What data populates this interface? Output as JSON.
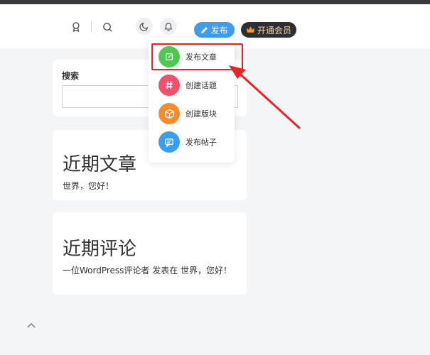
{
  "header": {
    "publish_label": "发布",
    "vip_label": "开通会员"
  },
  "search_widget": {
    "label": "搜索",
    "value": "",
    "placeholder": ""
  },
  "recent_posts": {
    "title": "近期文章",
    "items": [
      "世界，您好！"
    ]
  },
  "recent_comments": {
    "title": "近期评论",
    "items": [
      "一位WordPress评论者 发表在 世界，您好！"
    ]
  },
  "publish_menu": {
    "items": [
      {
        "label": "发布文章",
        "icon": "pencil-icon",
        "color": "#4cc94f"
      },
      {
        "label": "创建话题",
        "icon": "hashtag-icon",
        "color": "#f2506c"
      },
      {
        "label": "创建版块",
        "icon": "cube-icon",
        "color": "#f58b2d"
      },
      {
        "label": "发布帖子",
        "icon": "chat-bubble-icon",
        "color": "#3a9ef0"
      }
    ]
  },
  "colors": {
    "accent": "#3f9cf0",
    "annotation": "#e8232a",
    "vip_bg": "#2f2f33"
  }
}
